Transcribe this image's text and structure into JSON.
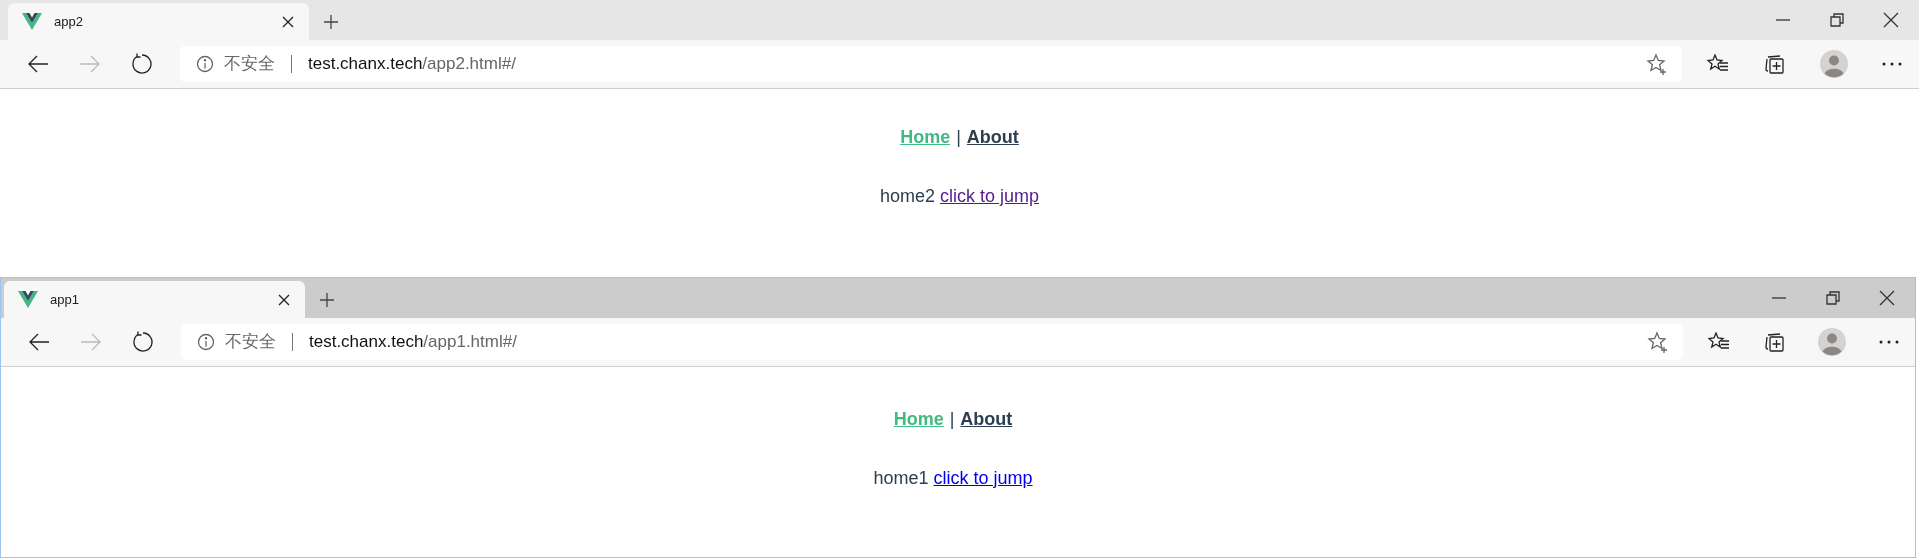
{
  "windows": [
    {
      "active": false,
      "tab": {
        "title": "app2"
      },
      "address": {
        "security": "不安全",
        "host": "test.chanx.tech",
        "path": "/app2.html#/"
      },
      "nav": [
        {
          "label": "Home",
          "selected": true
        },
        {
          "label": "About",
          "selected": false
        }
      ],
      "separator": "|",
      "text": "home2",
      "link": {
        "label": "click to jump",
        "visited": true
      }
    },
    {
      "active": true,
      "tab": {
        "title": "app1"
      },
      "address": {
        "security": "不安全",
        "host": "test.chanx.tech",
        "path": "/app1.html#/"
      },
      "nav": [
        {
          "label": "Home",
          "selected": true
        },
        {
          "label": "About",
          "selected": false
        }
      ],
      "separator": "|",
      "text": "home1",
      "link": {
        "label": "click to jump",
        "visited": false
      }
    }
  ]
}
